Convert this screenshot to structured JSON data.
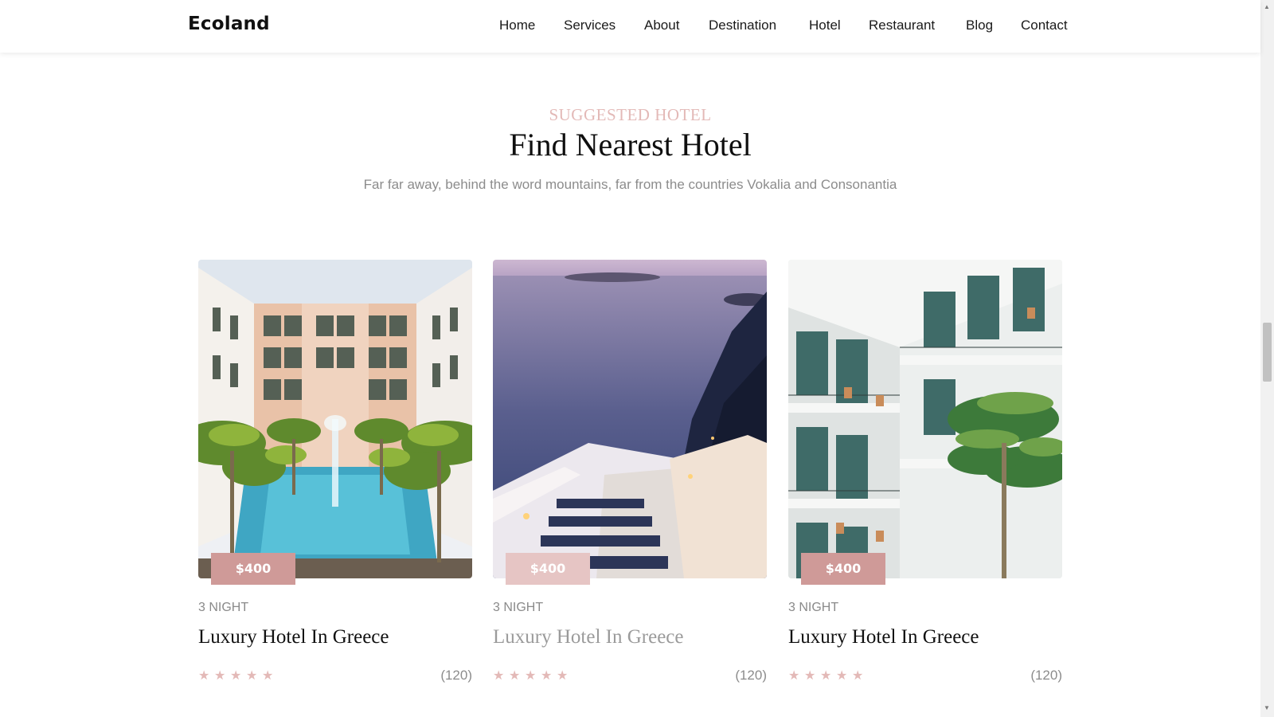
{
  "header": {
    "brand": "Ecoland",
    "nav": [
      {
        "label": "Home"
      },
      {
        "label": "Services"
      },
      {
        "label": "About"
      },
      {
        "label": "Destination"
      },
      {
        "label": "Hotel"
      },
      {
        "label": "Restaurant"
      },
      {
        "label": "Blog"
      },
      {
        "label": "Contact"
      }
    ]
  },
  "section": {
    "eyebrow": "SUGGESTED HOTEL",
    "title": "Find Nearest Hotel",
    "subtitle": "Far far away, behind the word mountains, far from the countries Vokalia and Consonantia"
  },
  "cards": [
    {
      "photo": "hotel-courtyard-pool-photo",
      "price": "$400",
      "nights": "3 NIGHT",
      "name": "Luxury Hotel In Greece",
      "rating": 5,
      "reviews": "(120)"
    },
    {
      "photo": "santorini-stairs-sea-photo",
      "price": "$400",
      "nights": "3 NIGHT",
      "name": "Luxury Hotel In Greece",
      "rating": 5,
      "reviews": "(120)"
    },
    {
      "photo": "hotel-balconies-palm-photo",
      "price": "$400",
      "nights": "3 NIGHT",
      "name": "Luxury Hotel In Greece",
      "rating": 5,
      "reviews": "(120)"
    }
  ],
  "colors": {
    "accent": "#cf9a98",
    "accent_light": "#e3b9b7",
    "text_muted": "#8c8c8c"
  },
  "icons": {
    "star": "star-icon",
    "scroll_up": "scroll-up-arrow-icon",
    "scroll_down": "scroll-down-arrow-icon"
  }
}
